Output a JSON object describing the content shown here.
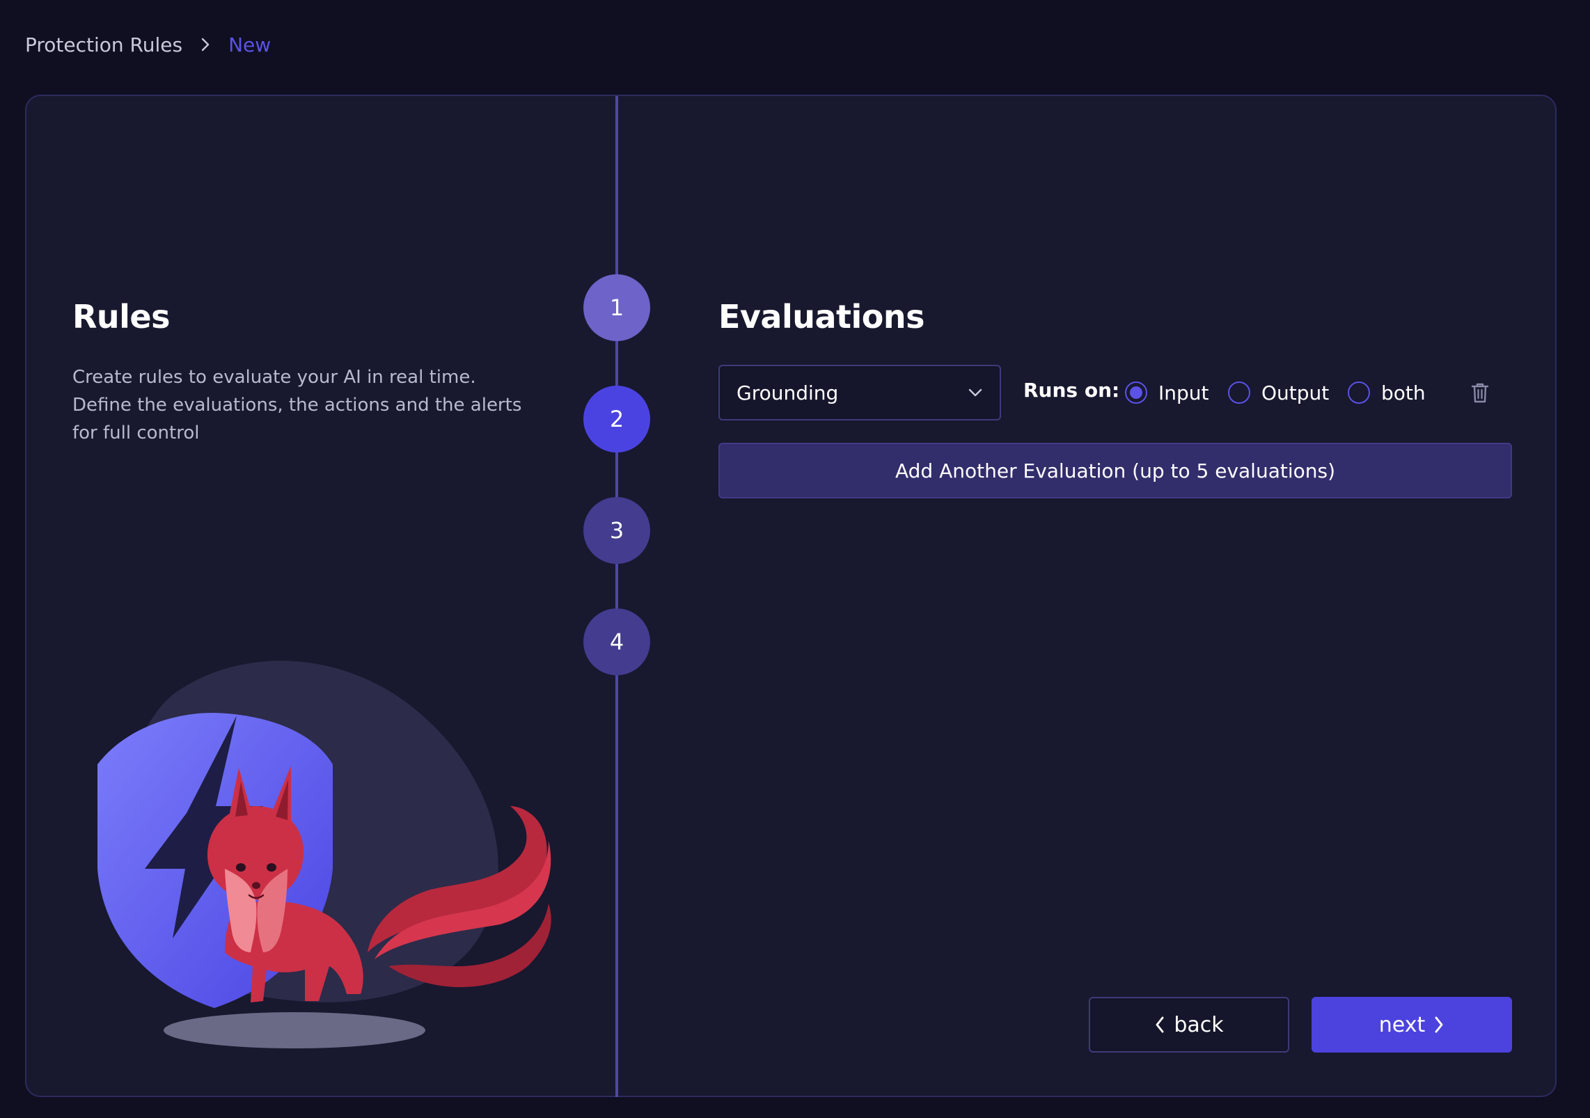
{
  "breadcrumb": {
    "root": "Protection Rules",
    "current": "New"
  },
  "left": {
    "title": "Rules",
    "description": "Create rules to evaluate your AI in real time. Define the evaluations, the actions and the alerts for full control"
  },
  "stepper": {
    "steps": [
      "1",
      "2",
      "3",
      "4"
    ],
    "active_step": 2
  },
  "evaluations": {
    "title": "Evaluations",
    "selected_evaluation": "Grounding",
    "runs_on_label": "Runs on:",
    "runs_on_options": [
      "Input",
      "Output",
      "both"
    ],
    "runs_on_selected": "Input",
    "add_button_label": "Add Another Evaluation (up to 5 evaluations)"
  },
  "footer": {
    "back_label": "back",
    "next_label": "next"
  },
  "icons": {
    "breadcrumb_separator": "chevron-right-icon",
    "select_arrow": "chevron-down-icon",
    "delete": "trash-icon",
    "back": "chevron-left-icon",
    "next": "chevron-right-icon"
  },
  "colors": {
    "page_background": "#0f0f21",
    "card_background": "#18182f",
    "accent": "#4c43de",
    "accent_text": "#5b52e6",
    "step_line": "#4e48a5"
  }
}
